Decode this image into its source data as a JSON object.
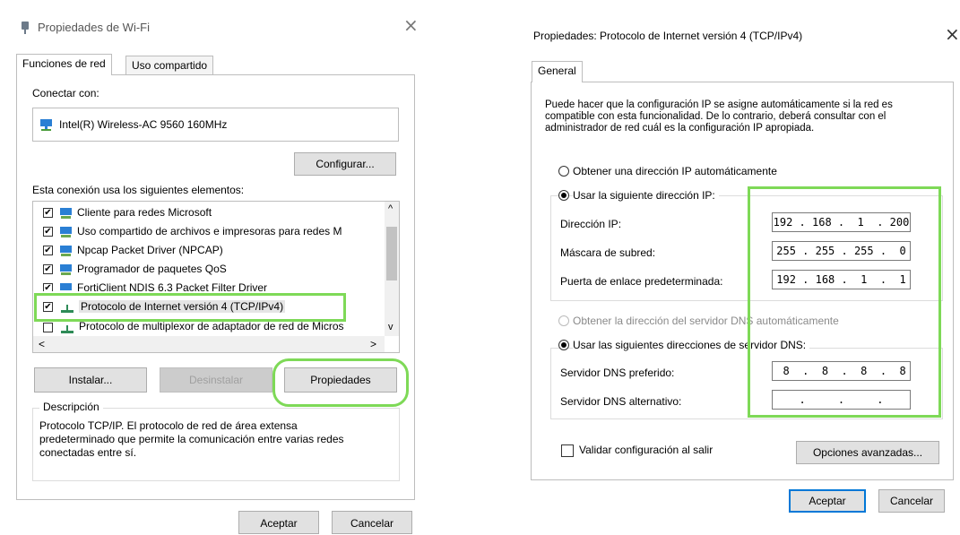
{
  "left": {
    "title": "Propiedades de Wi-Fi",
    "close": "×",
    "tabs": [
      "Funciones de red",
      "Uso compartido"
    ],
    "connect_with_label": "Conectar con:",
    "adapter_name": "Intel(R) Wireless-AC 9560 160MHz",
    "configure_button": "Configurar...",
    "elements_label": "Esta conexión usa los siguientes elementos:",
    "items": [
      {
        "label": "Cliente para redes Microsoft",
        "checked": true
      },
      {
        "label": "Uso compartido de archivos e impresoras para redes M",
        "checked": true
      },
      {
        "label": "Npcap Packet Driver (NPCAP)",
        "checked": true
      },
      {
        "label": "Programador de paquetes QoS",
        "checked": true
      },
      {
        "label": "FortiClient NDIS 6.3 Packet Filter Driver",
        "checked": true
      },
      {
        "label": "Protocolo de Internet versión 4 (TCP/IPv4)",
        "checked": true
      },
      {
        "label": "Protocolo de multiplexor de adaptador de red de Micros",
        "checked": false
      }
    ],
    "install_button": "Instalar...",
    "uninstall_button": "Desinstalar",
    "properties_button": "Propiedades",
    "description_label": "Descripción",
    "description_text": "Protocolo TCP/IP. El protocolo de red de área extensa predeterminado que permite la comunicación entre varias redes conectadas entre sí.",
    "ok_button": "Aceptar",
    "cancel_button": "Cancelar",
    "checkmark": "✔",
    "scroll_up": "^",
    "scroll_down": "v",
    "scroll_left": "<",
    "scroll_right": ">"
  },
  "right": {
    "title": "Propiedades: Protocolo de Internet versión 4 (TCP/IPv4)",
    "close": "×",
    "tab": "General",
    "intro": "Puede hacer que la configuración IP se asigne automáticamente si la red es compatible con esta funcionalidad. De lo contrario, deberá consultar con el administrador de red cuál es la configuración IP apropiada.",
    "auto_ip": "Obtener una dirección IP automáticamente",
    "manual_ip": "Usar la siguiente dirección IP:",
    "ip_label": "Dirección IP:",
    "ip_value": "192 . 168 .  1  . 200",
    "mask_label": "Máscara de subred:",
    "mask_value": "255 . 255 . 255 .  0",
    "gateway_label": "Puerta de enlace predeterminada:",
    "gateway_value": "192 . 168 .  1  .  1",
    "auto_dns": "Obtener la dirección del servidor DNS automáticamente",
    "manual_dns": "Usar las siguientes direcciones de servidor DNS:",
    "dns_pref_label": "Servidor DNS preferido:",
    "dns_pref_value": " 8  .  8  .  8  .  8",
    "dns_alt_label": "Servidor DNS alternativo:",
    "dns_alt_value": "    .     .     .    ",
    "validate_label": "Validar configuración al salir",
    "advanced_button": "Opciones avanzadas...",
    "ok_button": "Aceptar",
    "cancel_button": "Cancelar"
  },
  "colors": {
    "highlight": "#7ed957",
    "accent": "#0078d7"
  }
}
